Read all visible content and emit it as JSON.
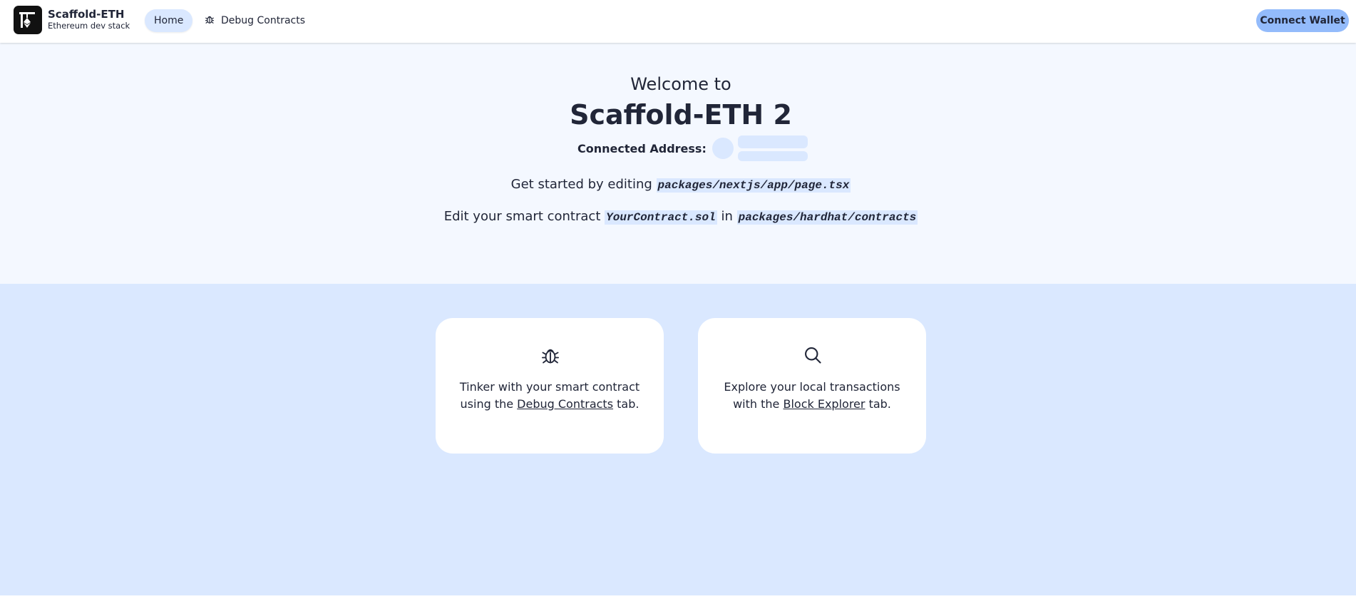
{
  "header": {
    "brand_title": "Scaffold-ETH",
    "brand_subtitle": "Ethereum dev stack",
    "nav": {
      "home_label": "Home",
      "debug_label": "Debug Contracts"
    },
    "connect_label": "Connect Wallet"
  },
  "hero": {
    "welcome": "Welcome to",
    "title": "Scaffold-ETH 2",
    "connected_label": "Connected Address:",
    "line1_text": "Get started by editing",
    "line1_code": "packages/nextjs/app/page.tsx",
    "line2_prefix": "Edit your smart contract",
    "line2_code1": "YourContract.sol",
    "line2_in": "in",
    "line2_code2": "packages/hardhat/contracts"
  },
  "cards": [
    {
      "icon": "bug-icon",
      "text_before": "Tinker with your smart contract using the",
      "link": "Debug Contracts",
      "text_after": "tab."
    },
    {
      "icon": "magnifying-glass-icon",
      "text_before": "Explore your local transactions with the",
      "link": "Block Explorer",
      "text_after": "tab."
    }
  ],
  "colors": {
    "primary": "#93bbfb",
    "secondary": "#dae8ff",
    "base_200": "#f4f8ff",
    "text": "#212638"
  }
}
